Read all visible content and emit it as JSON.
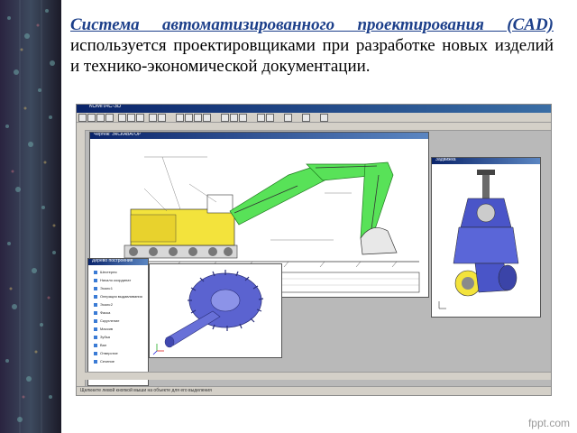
{
  "heading": {
    "emphasis": "Система автоматизированного проектирования (CAD) ",
    "rest": "используется проектировщиками при разработке новых изделий и технико-экономической документации."
  },
  "screenshot": {
    "window_title": "КОМПАС-3D",
    "drawing_window_title": "Чертеж: ЭКСКАВАТОР",
    "model_window_title": "Задвижка",
    "tree_window_title": "Дерево построения",
    "tree_items": [
      "Шестерня",
      "Начало координат",
      "Эскиз:1",
      "Операция выдавливания",
      "Эскиз:2",
      "Фаска",
      "Скругление",
      "Массив",
      "Зубья",
      "Вал",
      "Отверстие",
      "Сечение"
    ],
    "status": "Щелкните левой кнопкой мыши на объекте для его выделения"
  },
  "colors": {
    "accent": "#1c3f8a",
    "excavator_yellow": "#f3e33c",
    "excavator_green": "#58e258",
    "part_blue": "#4a55c8"
  },
  "watermark": "fppt.com"
}
